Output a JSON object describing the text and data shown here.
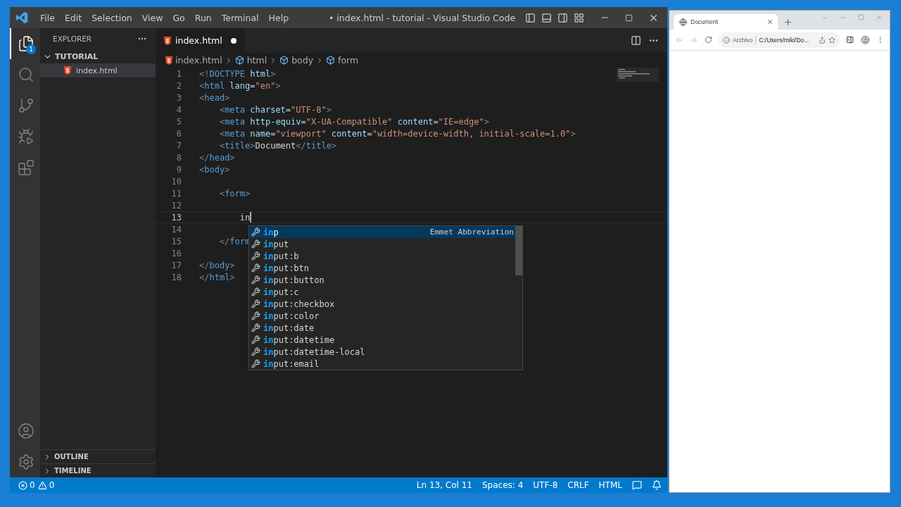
{
  "vscode": {
    "title": "• index.html - tutorial - Visual Studio Code",
    "menu": [
      "File",
      "Edit",
      "Selection",
      "View",
      "Go",
      "Run",
      "Terminal",
      "Help"
    ],
    "activity_bar": [
      {
        "kind": "explorer",
        "selected": true,
        "badge": "1"
      },
      {
        "kind": "search",
        "selected": false
      },
      {
        "kind": "source-control",
        "selected": false
      },
      {
        "kind": "run-debug",
        "selected": false
      },
      {
        "kind": "extensions",
        "selected": false
      }
    ],
    "activity_bottom": [
      {
        "kind": "account"
      },
      {
        "kind": "settings"
      }
    ],
    "sidebar": {
      "title": "EXPLORER",
      "folder": {
        "name": "TUTORIAL",
        "expanded": true,
        "files": [
          {
            "name": "index.html",
            "selected": true
          }
        ]
      },
      "sections": [
        {
          "name": "OUTLINE",
          "expanded": false
        },
        {
          "name": "TIMELINE",
          "expanded": false
        }
      ]
    },
    "tabs": [
      {
        "label": "index.html",
        "selected": true,
        "modified": true
      }
    ],
    "breadcrumbs": [
      {
        "label": "index.html",
        "kind": "file"
      },
      {
        "label": "html",
        "kind": "element"
      },
      {
        "label": "body",
        "kind": "element"
      },
      {
        "label": "form",
        "kind": "element"
      }
    ],
    "lines": [
      {
        "number": "1",
        "current": false,
        "tokens": [
          {
            "text": "<!",
            "kind": "punct"
          },
          {
            "text": "DOCTYPE",
            "kind": "tag"
          },
          {
            "text": " html",
            "kind": "attr"
          },
          {
            "text": ">",
            "kind": "punct"
          }
        ]
      },
      {
        "number": "2",
        "current": false,
        "tokens": [
          {
            "text": "<",
            "kind": "punct"
          },
          {
            "text": "html",
            "kind": "tag"
          },
          {
            "text": " lang",
            "kind": "attr"
          },
          {
            "text": "=",
            "kind": "text"
          },
          {
            "text": "\"en\"",
            "kind": "string"
          },
          {
            "text": ">",
            "kind": "punct"
          }
        ]
      },
      {
        "number": "3",
        "current": false,
        "tokens": [
          {
            "text": "<",
            "kind": "punct"
          },
          {
            "text": "head",
            "kind": "tag"
          },
          {
            "text": ">",
            "kind": "punct"
          }
        ]
      },
      {
        "number": "4",
        "current": false,
        "tokens": [
          {
            "text": "    <",
            "kind": "punct"
          },
          {
            "text": "meta",
            "kind": "tag"
          },
          {
            "text": " charset",
            "kind": "attr"
          },
          {
            "text": "=",
            "kind": "text"
          },
          {
            "text": "\"UTF-8\"",
            "kind": "string"
          },
          {
            "text": ">",
            "kind": "punct"
          }
        ]
      },
      {
        "number": "5",
        "current": false,
        "tokens": [
          {
            "text": "    <",
            "kind": "punct"
          },
          {
            "text": "meta",
            "kind": "tag"
          },
          {
            "text": " http-equiv",
            "kind": "attr"
          },
          {
            "text": "=",
            "kind": "text"
          },
          {
            "text": "\"X-UA-Compatible\"",
            "kind": "string"
          },
          {
            "text": " content",
            "kind": "attr"
          },
          {
            "text": "=",
            "kind": "text"
          },
          {
            "text": "\"IE=edge\"",
            "kind": "string"
          },
          {
            "text": ">",
            "kind": "punct"
          }
        ]
      },
      {
        "number": "6",
        "current": false,
        "tokens": [
          {
            "text": "    <",
            "kind": "punct"
          },
          {
            "text": "meta",
            "kind": "tag"
          },
          {
            "text": " name",
            "kind": "attr"
          },
          {
            "text": "=",
            "kind": "text"
          },
          {
            "text": "\"viewport\"",
            "kind": "string"
          },
          {
            "text": " content",
            "kind": "attr"
          },
          {
            "text": "=",
            "kind": "text"
          },
          {
            "text": "\"width=device-width, initial-scale=1.0\"",
            "kind": "string"
          },
          {
            "text": ">",
            "kind": "punct"
          }
        ]
      },
      {
        "number": "7",
        "current": false,
        "tokens": [
          {
            "text": "    <",
            "kind": "punct"
          },
          {
            "text": "title",
            "kind": "tag"
          },
          {
            "text": ">",
            "kind": "punct"
          },
          {
            "text": "Document",
            "kind": "text"
          },
          {
            "text": "</",
            "kind": "punct"
          },
          {
            "text": "title",
            "kind": "tag"
          },
          {
            "text": ">",
            "kind": "punct"
          }
        ]
      },
      {
        "number": "8",
        "current": false,
        "tokens": [
          {
            "text": "</",
            "kind": "punct"
          },
          {
            "text": "head",
            "kind": "tag"
          },
          {
            "text": ">",
            "kind": "punct"
          }
        ]
      },
      {
        "number": "9",
        "current": false,
        "tokens": [
          {
            "text": "<",
            "kind": "punct"
          },
          {
            "text": "body",
            "kind": "tag"
          },
          {
            "text": ">",
            "kind": "punct"
          }
        ]
      },
      {
        "number": "10",
        "current": false
      },
      {
        "number": "11",
        "current": false,
        "tokens": [
          {
            "text": "    <",
            "kind": "punct"
          },
          {
            "text": "form",
            "kind": "tag"
          },
          {
            "text": ">",
            "kind": "punct"
          }
        ]
      },
      {
        "number": "12",
        "current": false
      },
      {
        "number": "13",
        "current": true,
        "tokens": [
          {
            "text": "        in",
            "kind": "text"
          }
        ]
      },
      {
        "number": "14",
        "current": false
      },
      {
        "number": "15",
        "current": false,
        "tokens": [
          {
            "text": "    </",
            "kind": "punct"
          },
          {
            "text": "form",
            "kind": "tag"
          }
        ]
      },
      {
        "number": "16",
        "current": false
      },
      {
        "number": "17",
        "current": false,
        "tokens": [
          {
            "text": "</",
            "kind": "punct"
          },
          {
            "text": "body",
            "kind": "tag"
          },
          {
            "text": ">",
            "kind": "punct"
          }
        ]
      },
      {
        "number": "18",
        "current": false,
        "tokens": [
          {
            "text": "</",
            "kind": "punct"
          },
          {
            "text": "html",
            "kind": "tag"
          },
          {
            "text": ">",
            "kind": "punct"
          }
        ]
      }
    ],
    "suggestions": [
      {
        "match": "in",
        "rest": "p",
        "selected": true,
        "detail": "Emmet Abbreviation"
      },
      {
        "match": "in",
        "rest": "put",
        "selected": false
      },
      {
        "match": "in",
        "rest": "put:b",
        "selected": false
      },
      {
        "match": "in",
        "rest": "put:btn",
        "selected": false
      },
      {
        "match": "in",
        "rest": "put:button",
        "selected": false
      },
      {
        "match": "in",
        "rest": "put:c",
        "selected": false
      },
      {
        "match": "in",
        "rest": "put:checkbox",
        "selected": false
      },
      {
        "match": "in",
        "rest": "put:color",
        "selected": false
      },
      {
        "match": "in",
        "rest": "put:date",
        "selected": false
      },
      {
        "match": "in",
        "rest": "put:datetime",
        "selected": false
      },
      {
        "match": "in",
        "rest": "put:datetime-local",
        "selected": false
      },
      {
        "match": "in",
        "rest": "put:email",
        "selected": false
      }
    ],
    "status_bar": {
      "errors": "0",
      "warnings": "0",
      "items": [
        "Ln 13, Col 11",
        "Spaces: 4",
        "UTF-8",
        "CRLF",
        "HTML"
      ]
    }
  },
  "browser": {
    "tab": {
      "title": "Document"
    },
    "address": {
      "label": "Archivo",
      "url": "C:/Users/miki/Do..."
    }
  }
}
